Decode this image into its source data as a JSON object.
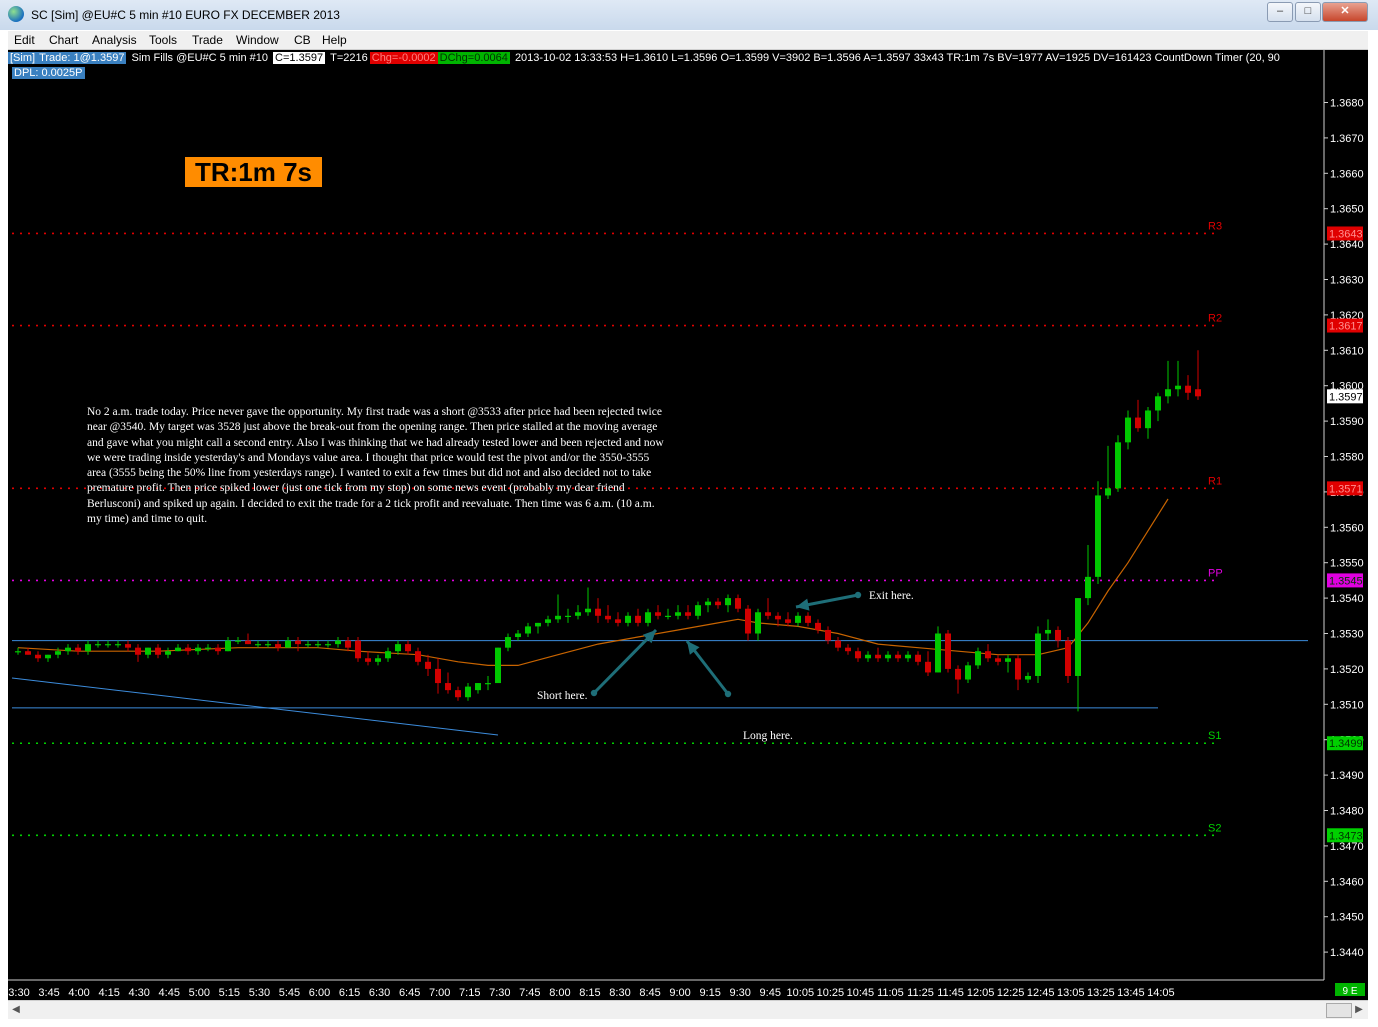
{
  "window": {
    "title": "SC [Sim] @EU#C  5 min   #10  EURO FX DECEMBER 2013",
    "minimize": "‒",
    "maximize": "□",
    "close": "✕"
  },
  "menu": [
    "Edit",
    "Chart",
    "Analysis",
    "Tools",
    "Trade",
    "Window",
    "CB",
    "Help"
  ],
  "info": {
    "sim": "[Sim]",
    "trade": "Trade: 1@1.3597",
    "fills": "Sim Fills   @EU#C  5 min   #10",
    "close": "C=1.3597",
    "ticks": "T=2216",
    "chg": "Chg=-0.0002",
    "dchg": "DChg=0.0064",
    "stats": "2013-10-02 13:33:53 H=1.3610 L=1.3596 O=1.3599 V=3902 B=1.3596 A=1.3597 33x43 TR:1m 7s BV=1977 AV=1925 DV=161423  CountDown Timer   (20, 90",
    "dpl": "DPL: 0.0025P"
  },
  "time_remaining": "TR:1m 7s",
  "note": "No 2 a.m. trade today. Price never gave the opportunity. My first trade was a short @3533 after price had been rejected twice near @3540. My target was 3528 just above the break-out from the opening range. Then price stalled at the moving average and gave what you might call a second entry. Also I was thinking that we had already tested lower and been rejected and now we were trading inside yesterday's and Mondays value area. I thought that price would test the pivot and/or the 3550-3555 area (3555 being the 50% line from yesterdays range). I wanted to exit a few times but did not and also decided not to take premature profit. Then price spiked lower (just one tick from my stop) on some news event (probably my dear friend Berlusconi) and spiked up again. I decided to exit the trade for a 2 tick profit and reevaluate. Then time was 6 a.m. (10 a.m. my time) and time to quit.",
  "annotations": [
    "Exit here.",
    "Short here.",
    "Long here."
  ],
  "colors": {
    "background": "#000000",
    "up_candle": "#00c800",
    "down_candle": "#d20000",
    "resistance": "#e00000",
    "pivot": "#e000e0",
    "support": "#00d000",
    "moving_average": "#c86400",
    "range_lines": "#3c8cdc",
    "arrows": "#1e6e78",
    "tr_badge": "#ff8c00"
  },
  "chart_data": {
    "type": "candlestick",
    "symbol": "@EU#C",
    "interval": "5 min",
    "y_ticks": [
      "1.3680",
      "1.3670",
      "1.3660",
      "1.3650",
      "1.3640",
      "1.3630",
      "1.3620",
      "1.3610",
      "1.3600",
      "1.3590",
      "1.3580",
      "1.3570",
      "1.3560",
      "1.3550",
      "1.3540",
      "1.3530",
      "1.3520",
      "1.3510",
      "1.3500",
      "1.3490",
      "1.3480",
      "1.3470",
      "1.3460",
      "1.3450",
      "1.3440"
    ],
    "x_ticks": [
      "3:30",
      "3:45",
      "4:00",
      "4:15",
      "4:30",
      "4:45",
      "5:00",
      "5:15",
      "5:30",
      "5:45",
      "6:00",
      "6:15",
      "6:30",
      "6:45",
      "7:00",
      "7:15",
      "7:30",
      "7:45",
      "8:00",
      "8:15",
      "8:30",
      "8:45",
      "9:00",
      "9:15",
      "9:30",
      "9:45",
      "10:05",
      "10:25",
      "10:45",
      "11:05",
      "11:25",
      "11:45",
      "12:05",
      "12:25",
      "12:45",
      "13:05",
      "13:25",
      "13:45",
      "14:05"
    ],
    "ylim": [
      1.3436,
      1.3691
    ],
    "levels": [
      {
        "name": "R3",
        "value": 1.3643
      },
      {
        "name": "R2",
        "value": 1.3617
      },
      {
        "name": "R1",
        "value": 1.3571
      },
      {
        "name": "PP",
        "value": 1.3545
      },
      {
        "name": "S1",
        "value": 1.3499
      },
      {
        "name": "S2",
        "value": 1.3473
      }
    ],
    "last_price": "1.3597",
    "corner_tag": "9 E",
    "range_high": 1.3528,
    "range_low": 1.3509,
    "candles": [
      [
        1.3525,
        1.3526,
        1.3524,
        1.3525
      ],
      [
        1.3525,
        1.3526,
        1.3524,
        1.3524
      ],
      [
        1.3524,
        1.3525,
        1.3522,
        1.3523
      ],
      [
        1.3523,
        1.3524,
        1.3522,
        1.3524
      ],
      [
        1.3524,
        1.3526,
        1.3523,
        1.3525
      ],
      [
        1.3525,
        1.3527,
        1.3524,
        1.3526
      ],
      [
        1.3526,
        1.3527,
        1.3524,
        1.3525
      ],
      [
        1.3525,
        1.3528,
        1.3524,
        1.3527
      ],
      [
        1.3527,
        1.3528,
        1.3526,
        1.3527
      ],
      [
        1.3527,
        1.3528,
        1.3526,
        1.3527
      ],
      [
        1.3527,
        1.3528,
        1.3526,
        1.3527
      ],
      [
        1.3527,
        1.3528,
        1.3525,
        1.3526
      ],
      [
        1.3526,
        1.3527,
        1.3522,
        1.3524
      ],
      [
        1.3524,
        1.3526,
        1.3523,
        1.3526
      ],
      [
        1.3526,
        1.3527,
        1.3523,
        1.3524
      ],
      [
        1.3524,
        1.3526,
        1.3523,
        1.3525
      ],
      [
        1.3525,
        1.3527,
        1.3525,
        1.3526
      ],
      [
        1.3526,
        1.3527,
        1.3524,
        1.3525
      ],
      [
        1.3525,
        1.3527,
        1.3524,
        1.3526
      ],
      [
        1.3526,
        1.3527,
        1.3525,
        1.3526
      ],
      [
        1.3526,
        1.3527,
        1.3524,
        1.3525
      ],
      [
        1.3525,
        1.3529,
        1.3525,
        1.3528
      ],
      [
        1.3528,
        1.3529,
        1.3527,
        1.3528
      ],
      [
        1.3528,
        1.353,
        1.3527,
        1.3527
      ],
      [
        1.3527,
        1.3528,
        1.3526,
        1.3527
      ],
      [
        1.3527,
        1.3528,
        1.3526,
        1.3527
      ],
      [
        1.3527,
        1.3528,
        1.3525,
        1.3526
      ],
      [
        1.3526,
        1.3529,
        1.3526,
        1.3528
      ],
      [
        1.3528,
        1.3529,
        1.3525,
        1.3527
      ],
      [
        1.3527,
        1.3528,
        1.3526,
        1.3527
      ],
      [
        1.3527,
        1.3528,
        1.3526,
        1.3527
      ],
      [
        1.3527,
        1.3528,
        1.3526,
        1.3527
      ],
      [
        1.3527,
        1.3529,
        1.3526,
        1.3528
      ],
      [
        1.3528,
        1.3529,
        1.3525,
        1.3526
      ],
      [
        1.3528,
        1.3529,
        1.3522,
        1.3523
      ],
      [
        1.3523,
        1.3525,
        1.3521,
        1.3522
      ],
      [
        1.3522,
        1.3524,
        1.3521,
        1.3523
      ],
      [
        1.3523,
        1.3526,
        1.3522,
        1.3525
      ],
      [
        1.3525,
        1.3528,
        1.3524,
        1.3527
      ],
      [
        1.3527,
        1.3528,
        1.3524,
        1.3525
      ],
      [
        1.3525,
        1.3526,
        1.3521,
        1.3522
      ],
      [
        1.3522,
        1.3524,
        1.3518,
        1.352
      ],
      [
        1.352,
        1.3523,
        1.3513,
        1.3516
      ],
      [
        1.3516,
        1.3519,
        1.3513,
        1.3514
      ],
      [
        1.3514,
        1.3515,
        1.3511,
        1.3512
      ],
      [
        1.3512,
        1.3516,
        1.3511,
        1.3515
      ],
      [
        1.3514,
        1.3516,
        1.3513,
        1.3516
      ],
      [
        1.3516,
        1.3518,
        1.3514,
        1.3516
      ],
      [
        1.3516,
        1.3526,
        1.3516,
        1.3526
      ],
      [
        1.3526,
        1.353,
        1.3525,
        1.3529
      ],
      [
        1.3529,
        1.3531,
        1.3528,
        1.353
      ],
      [
        1.353,
        1.3533,
        1.3529,
        1.3532
      ],
      [
        1.3532,
        1.3533,
        1.353,
        1.3533
      ],
      [
        1.3533,
        1.3535,
        1.3532,
        1.3534
      ],
      [
        1.3534,
        1.3541,
        1.3533,
        1.3535
      ],
      [
        1.3535,
        1.3537,
        1.3533,
        1.3535
      ],
      [
        1.3535,
        1.3538,
        1.3534,
        1.3536
      ],
      [
        1.3536,
        1.3543,
        1.3535,
        1.3537
      ],
      [
        1.3537,
        1.354,
        1.3533,
        1.3535
      ],
      [
        1.3535,
        1.3538,
        1.3533,
        1.3534
      ],
      [
        1.3534,
        1.3536,
        1.3532,
        1.3533
      ],
      [
        1.3533,
        1.3536,
        1.3532,
        1.3535
      ],
      [
        1.3535,
        1.3537,
        1.3532,
        1.3533
      ],
      [
        1.3533,
        1.3537,
        1.3532,
        1.3536
      ],
      [
        1.3536,
        1.3538,
        1.3534,
        1.3535
      ],
      [
        1.3535,
        1.3537,
        1.3534,
        1.3535
      ],
      [
        1.3535,
        1.3538,
        1.3534,
        1.3536
      ],
      [
        1.3536,
        1.3538,
        1.3534,
        1.3535
      ],
      [
        1.3535,
        1.3539,
        1.3534,
        1.3538
      ],
      [
        1.3538,
        1.354,
        1.3536,
        1.3539
      ],
      [
        1.3539,
        1.354,
        1.3537,
        1.3538
      ],
      [
        1.3538,
        1.3541,
        1.3536,
        1.354
      ],
      [
        1.354,
        1.3541,
        1.3536,
        1.3537
      ],
      [
        1.3537,
        1.3538,
        1.3528,
        1.353
      ],
      [
        1.353,
        1.3537,
        1.3528,
        1.3536
      ],
      [
        1.3536,
        1.354,
        1.3534,
        1.3535
      ],
      [
        1.3535,
        1.3536,
        1.3532,
        1.3534
      ],
      [
        1.3534,
        1.3536,
        1.3532,
        1.3533
      ],
      [
        1.3533,
        1.3536,
        1.3532,
        1.3535
      ],
      [
        1.3535,
        1.3536,
        1.3532,
        1.3533
      ],
      [
        1.3533,
        1.3534,
        1.353,
        1.3531
      ],
      [
        1.3531,
        1.3532,
        1.3527,
        1.3528
      ],
      [
        1.3528,
        1.3529,
        1.3525,
        1.3526
      ],
      [
        1.3526,
        1.3527,
        1.3524,
        1.3525
      ],
      [
        1.3525,
        1.3526,
        1.3522,
        1.3523
      ],
      [
        1.3523,
        1.3525,
        1.3522,
        1.3524
      ],
      [
        1.3524,
        1.3526,
        1.3522,
        1.3523
      ],
      [
        1.3523,
        1.3525,
        1.3522,
        1.3524
      ],
      [
        1.3524,
        1.3525,
        1.3522,
        1.3523
      ],
      [
        1.3523,
        1.3525,
        1.3522,
        1.3524
      ],
      [
        1.3524,
        1.3525,
        1.3521,
        1.3522
      ],
      [
        1.3522,
        1.3525,
        1.3518,
        1.3519
      ],
      [
        1.3519,
        1.3532,
        1.3519,
        1.353
      ],
      [
        1.353,
        1.3531,
        1.3519,
        1.352
      ],
      [
        1.352,
        1.3521,
        1.3513,
        1.3517
      ],
      [
        1.3517,
        1.3522,
        1.3516,
        1.3521
      ],
      [
        1.3521,
        1.3526,
        1.352,
        1.3525
      ],
      [
        1.3525,
        1.3527,
        1.3522,
        1.3523
      ],
      [
        1.3523,
        1.3524,
        1.3521,
        1.3522
      ],
      [
        1.3522,
        1.3524,
        1.3519,
        1.3523
      ],
      [
        1.3523,
        1.3524,
        1.3514,
        1.3517
      ],
      [
        1.3517,
        1.3519,
        1.3516,
        1.3518
      ],
      [
        1.3518,
        1.3532,
        1.3516,
        1.353
      ],
      [
        1.353,
        1.3534,
        1.3528,
        1.3531
      ],
      [
        1.3531,
        1.3532,
        1.3526,
        1.3528
      ],
      [
        1.3528,
        1.3529,
        1.3516,
        1.3518
      ],
      [
        1.3518,
        1.354,
        1.3508,
        1.354
      ],
      [
        1.354,
        1.3555,
        1.3538,
        1.3546
      ],
      [
        1.3546,
        1.3573,
        1.3544,
        1.3569
      ],
      [
        1.3569,
        1.3583,
        1.3568,
        1.3571
      ],
      [
        1.3571,
        1.3586,
        1.357,
        1.3584
      ],
      [
        1.3584,
        1.3593,
        1.3582,
        1.3591
      ],
      [
        1.3591,
        1.3596,
        1.3587,
        1.3588
      ],
      [
        1.3588,
        1.3594,
        1.3585,
        1.3593
      ],
      [
        1.3593,
        1.3598,
        1.359,
        1.3597
      ],
      [
        1.3597,
        1.3607,
        1.3595,
        1.3599
      ],
      [
        1.3599,
        1.3607,
        1.3597,
        1.36
      ],
      [
        1.36,
        1.3603,
        1.3596,
        1.3598
      ],
      [
        1.3599,
        1.361,
        1.3596,
        1.3597
      ]
    ],
    "moving_average": [
      [
        0,
        1.3526
      ],
      [
        6,
        1.3525
      ],
      [
        14,
        1.3525
      ],
      [
        22,
        1.3526
      ],
      [
        30,
        1.3526
      ],
      [
        34,
        1.3525
      ],
      [
        40,
        1.3524
      ],
      [
        44,
        1.3522
      ],
      [
        47,
        1.3521
      ],
      [
        50,
        1.3521
      ],
      [
        54,
        1.3524
      ],
      [
        58,
        1.3527
      ],
      [
        62,
        1.3529
      ],
      [
        66,
        1.3531
      ],
      [
        70,
        1.3533
      ],
      [
        72,
        1.3534
      ],
      [
        74,
        1.3533
      ],
      [
        78,
        1.3532
      ],
      [
        82,
        1.353
      ],
      [
        86,
        1.3527
      ],
      [
        90,
        1.3526
      ],
      [
        94,
        1.3525
      ],
      [
        98,
        1.3524
      ],
      [
        102,
        1.3524
      ],
      [
        105,
        1.3526
      ],
      [
        107,
        1.3533
      ],
      [
        109,
        1.3542
      ],
      [
        111,
        1.355
      ],
      [
        113,
        1.3559
      ],
      [
        115,
        1.3568
      ]
    ]
  }
}
